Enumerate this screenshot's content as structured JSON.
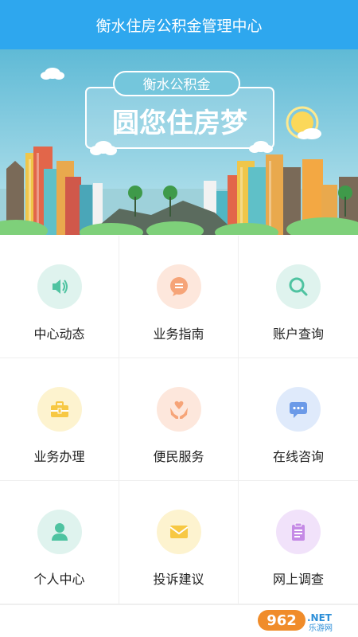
{
  "header": {
    "title": "衡水住房公积金管理中心"
  },
  "banner": {
    "tag": "衡水公积金",
    "slogan": "圆您住房梦"
  },
  "menu": [
    {
      "label": "中心动态",
      "icon": "speaker-icon",
      "bg": "#dff3ee",
      "fg": "#4fc3a1"
    },
    {
      "label": "业务指南",
      "icon": "chat-bubble-icon",
      "bg": "#fde7dc",
      "fg": "#f6a478"
    },
    {
      "label": "账户查询",
      "icon": "search-icon",
      "bg": "#dff3ee",
      "fg": "#4fc3a1"
    },
    {
      "label": "业务办理",
      "icon": "briefcase-icon",
      "bg": "#fdf3cf",
      "fg": "#f7c843"
    },
    {
      "label": "便民服务",
      "icon": "heart-hands-icon",
      "bg": "#fde7dc",
      "fg": "#f6a478"
    },
    {
      "label": "在线咨询",
      "icon": "message-icon",
      "bg": "#dfeafb",
      "fg": "#6b9ae8"
    },
    {
      "label": "个人中心",
      "icon": "user-icon",
      "bg": "#dff3ee",
      "fg": "#4fc3a1"
    },
    {
      "label": "投诉建议",
      "icon": "envelope-icon",
      "bg": "#fdf3cf",
      "fg": "#f7c843"
    },
    {
      "label": "网上调查",
      "icon": "clipboard-icon",
      "bg": "#f1e2fa",
      "fg": "#c58ae6"
    }
  ],
  "watermark": {
    "number": "962",
    "suffix": ".NET",
    "text": "乐游网"
  }
}
